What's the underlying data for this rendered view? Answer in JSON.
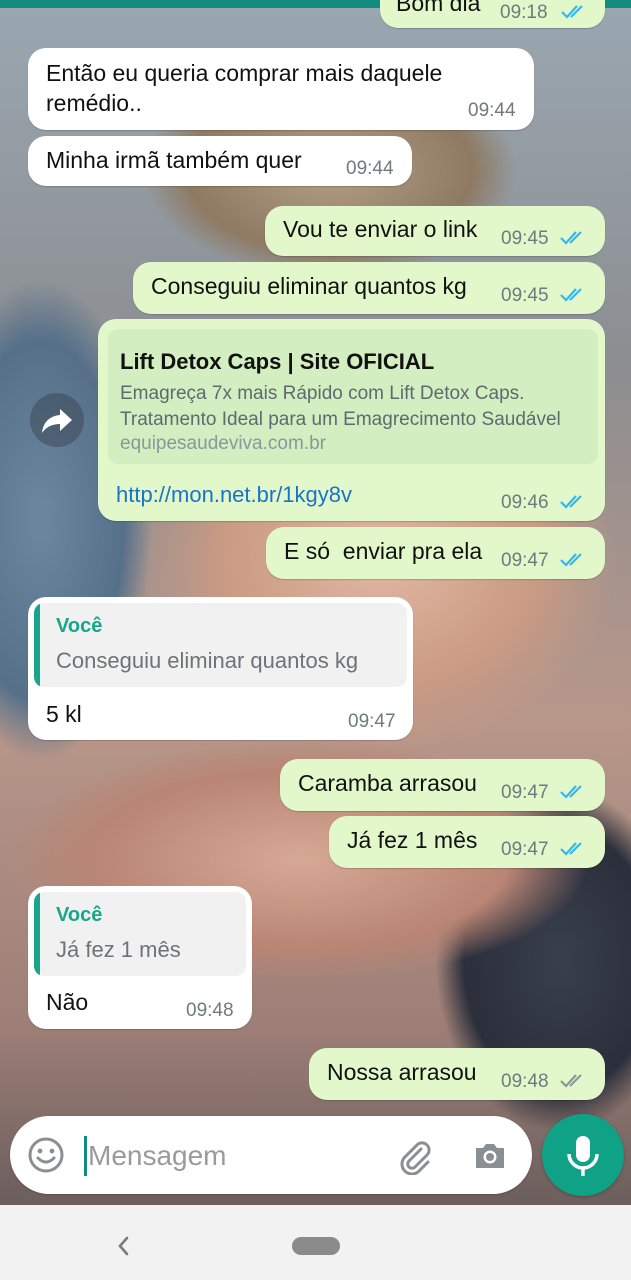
{
  "conversation": {
    "partial_top": {
      "text": "Bom dia",
      "time": "09:18"
    },
    "messages": [
      {
        "text_line1": "Então eu queria comprar mais daquele",
        "text_line2": "remédio..",
        "time": "09:44"
      },
      {
        "text": "Minha irmã também quer",
        "time": "09:44"
      },
      {
        "text": "Vou te enviar o link",
        "time": "09:45",
        "status": "read"
      },
      {
        "text": "Conseguiu eliminar quantos kg",
        "time": "09:45",
        "status": "read"
      },
      {
        "link_preview": {
          "title": "Lift Detox Caps | Site OFICIAL",
          "description_line1": "Emagreça 7x mais Rápido com Lift Detox Caps.",
          "description_line2": "Tratamento Ideal para um Emagrecimento Saudável",
          "domain": "equipesaudeviva.com.br"
        },
        "url": "http://mon.net.br/1kgy8v",
        "time": "09:46",
        "status": "read"
      },
      {
        "text": "E só  enviar pra ela",
        "time": "09:47",
        "status": "read"
      },
      {
        "quote_author": "Você",
        "quote_text": "Conseguiu eliminar quantos kg",
        "text": "5 kl",
        "time": "09:47"
      },
      {
        "text": "Caramba arrasou",
        "time": "09:47",
        "status": "read"
      },
      {
        "text": "Já fez 1 mês",
        "time": "09:47",
        "status": "read"
      },
      {
        "quote_author": "Você",
        "quote_text": "Já fez 1 mês",
        "text": "Não",
        "time": "09:48"
      },
      {
        "text": "Nossa arrasou",
        "time": "09:48",
        "status": "delivered"
      }
    ]
  },
  "composer": {
    "placeholder": "Mensagem",
    "icons": [
      "emoji-icon",
      "attach-icon",
      "camera-icon",
      "mic-icon"
    ]
  },
  "colors": {
    "accent": "#128c7e",
    "outgoing_bubble": "#e2f8cb",
    "incoming_bubble": "#ffffff",
    "read_tick": "#34b7f1",
    "delivered_tick": "#8c979c",
    "link": "#1a73c8"
  },
  "nav": {
    "icons": [
      "back-icon",
      "home-pill-icon"
    ]
  }
}
